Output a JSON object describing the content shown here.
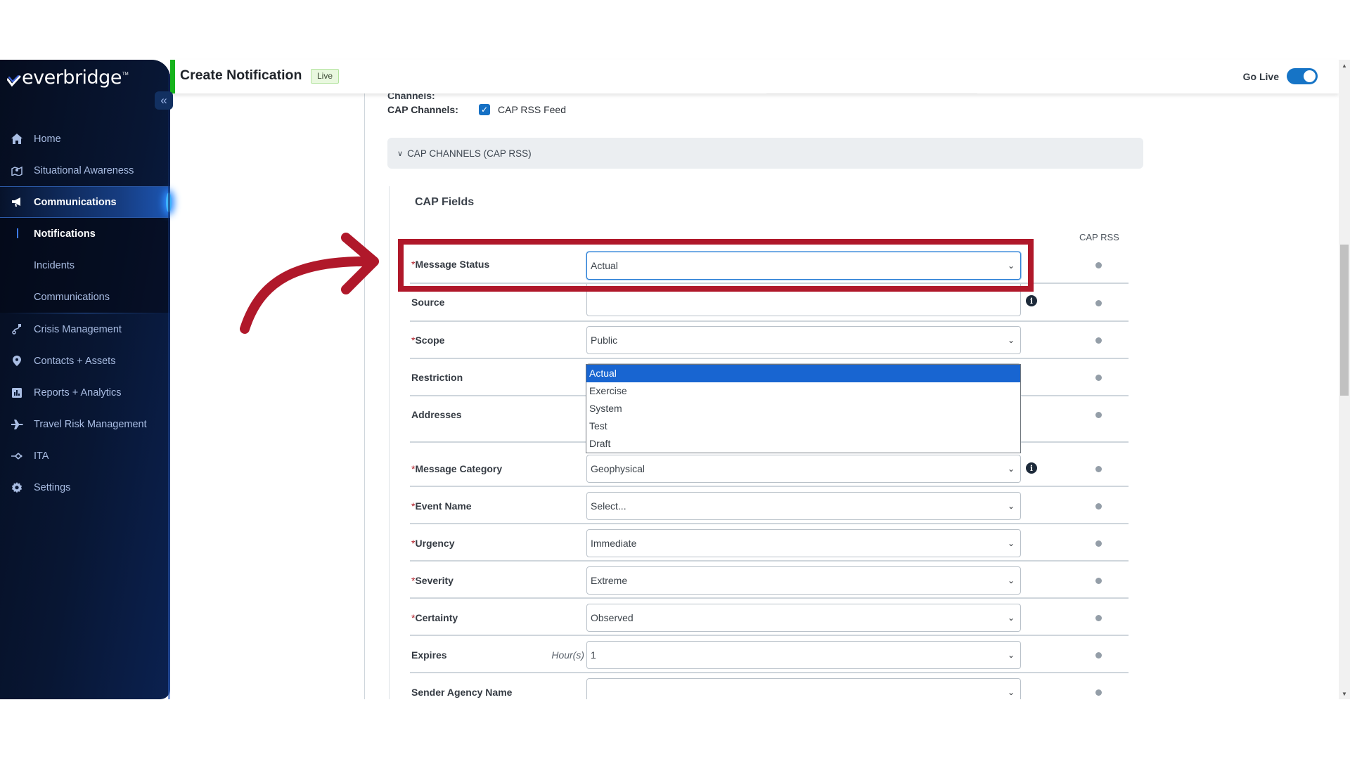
{
  "app": {
    "brand": "everbridge",
    "collapse_icon": "«"
  },
  "sidebar": {
    "items": [
      {
        "label": "Home",
        "icon": "home-icon"
      },
      {
        "label": "Situational Awareness",
        "icon": "map-icon"
      },
      {
        "label": "Communications",
        "icon": "megaphone-icon",
        "active": true
      },
      {
        "label": "Crisis Management",
        "icon": "route-icon"
      },
      {
        "label": "Contacts + Assets",
        "icon": "location-pin-icon"
      },
      {
        "label": "Reports + Analytics",
        "icon": "bar-chart-icon"
      },
      {
        "label": "Travel Risk Management",
        "icon": "airplane-icon"
      },
      {
        "label": "ITA",
        "icon": "network-icon"
      },
      {
        "label": "Settings",
        "icon": "gear-icon"
      }
    ],
    "sub_items": [
      {
        "label": "Notifications",
        "current": true
      },
      {
        "label": "Incidents"
      },
      {
        "label": "Communications"
      }
    ]
  },
  "header": {
    "title": "Create Notification",
    "badge": "Live",
    "go_live_label": "Go Live",
    "go_live_on": true
  },
  "content": {
    "channels_label": "Channels:",
    "cap_channels_label": "CAP Channels:",
    "cap_rss_feed_label": "CAP RSS Feed",
    "cap_rss_feed_checked": true,
    "accordion_label": "CAP CHANNELS (CAP RSS)",
    "fields_title": "CAP Fields",
    "column_header": "CAP RSS",
    "rows": [
      {
        "label": "Message Status",
        "required": true,
        "value": "Actual",
        "type": "select"
      },
      {
        "label": "Source",
        "required": false,
        "value": "",
        "type": "text",
        "info": true
      },
      {
        "label": "Scope",
        "required": true,
        "value": "Public",
        "type": "select"
      },
      {
        "label": "Restriction",
        "required": false,
        "value": "",
        "type": "text"
      },
      {
        "label": "Addresses",
        "required": false,
        "value": "",
        "type": "text"
      },
      {
        "label": "Message Category",
        "required": true,
        "value": "Geophysical",
        "type": "select",
        "info": true
      },
      {
        "label": "Event Name",
        "required": true,
        "value": "Select...",
        "type": "select"
      },
      {
        "label": "Urgency",
        "required": true,
        "value": "Immediate",
        "type": "select"
      },
      {
        "label": "Severity",
        "required": true,
        "value": "Extreme",
        "type": "select"
      },
      {
        "label": "Certainty",
        "required": true,
        "value": "Observed",
        "type": "select"
      },
      {
        "label": "Expires",
        "required": false,
        "value": "1",
        "unit": "Hour(s)",
        "type": "select"
      },
      {
        "label": "Sender Agency Name",
        "required": false,
        "value": "",
        "type": "select"
      }
    ],
    "message_status_options": [
      "Actual",
      "Exercise",
      "System",
      "Test",
      "Draft"
    ],
    "message_status_selected": "Actual"
  },
  "annotation": {
    "color": "#b0182a"
  }
}
